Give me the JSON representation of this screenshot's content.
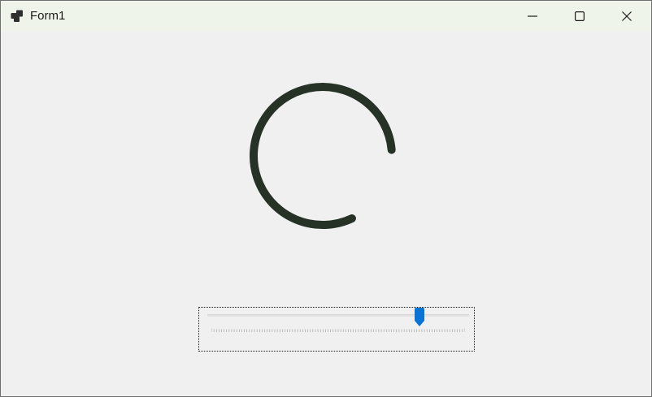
{
  "window": {
    "title": "Form1",
    "icon": "windows-forms-app-icon",
    "caption_buttons": [
      "minimize-icon",
      "maximize-icon",
      "close-icon"
    ]
  },
  "spinner": {
    "color": "#263226",
    "arc_start_deg": 5,
    "arc_end_deg": 295
  },
  "trackbar": {
    "value_fraction": 0.82,
    "tick_count": 100,
    "thumb_color": "#0a74d4"
  }
}
